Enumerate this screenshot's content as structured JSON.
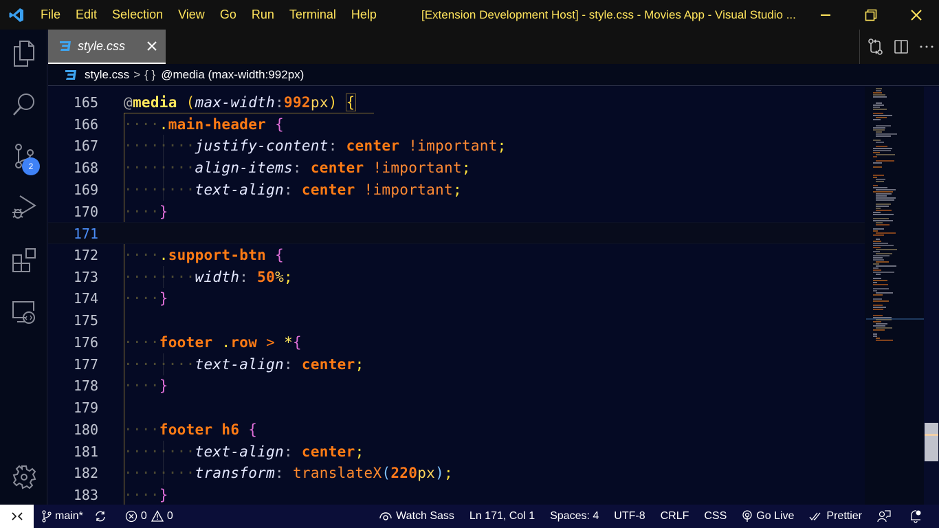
{
  "titlebar": {
    "menu": [
      "File",
      "Edit",
      "Selection",
      "View",
      "Go",
      "Run",
      "Terminal",
      "Help"
    ],
    "window_title": "[Extension Development Host] - style.css - Movies App - Visual Studio ...",
    "icons": [
      "vscode-logo-icon",
      "minimize-icon",
      "restore-icon",
      "close-icon"
    ]
  },
  "activitybar": {
    "items": [
      {
        "name": "explorer",
        "icon": "files-icon"
      },
      {
        "name": "search",
        "icon": "search-icon"
      },
      {
        "name": "source-control",
        "icon": "source-control-icon",
        "badge": "2"
      },
      {
        "name": "run-debug",
        "icon": "run-debug-icon"
      },
      {
        "name": "extensions",
        "icon": "extensions-icon"
      },
      {
        "name": "remote-explorer",
        "icon": "remote-explorer-icon"
      }
    ],
    "manage_icon": "gear-icon"
  },
  "tabs": [
    {
      "label": "style.css",
      "icon": "css-file-icon",
      "active": true
    }
  ],
  "editor_actions": [
    "open-changes-icon",
    "split-editor-icon",
    "more-actions-icon"
  ],
  "breadcrumb": {
    "file": "style.css",
    "separator": ">",
    "symbol_icon": "{ }",
    "symbol": "@media (max-width:992px)"
  },
  "editor": {
    "active_line": 171,
    "lines": [
      {
        "n": "165"
      },
      {
        "n": "166"
      },
      {
        "n": "167"
      },
      {
        "n": "168"
      },
      {
        "n": "169"
      },
      {
        "n": "170"
      },
      {
        "n": "171"
      },
      {
        "n": "172"
      },
      {
        "n": "173"
      },
      {
        "n": "174"
      },
      {
        "n": "175"
      },
      {
        "n": "176"
      },
      {
        "n": "177"
      },
      {
        "n": "178"
      },
      {
        "n": "179"
      },
      {
        "n": "180"
      },
      {
        "n": "181"
      },
      {
        "n": "182"
      },
      {
        "n": "183"
      }
    ],
    "tokens": {
      "l165": {
        "at": "@",
        "kw": "media",
        "open": "(",
        "prop": "max-width",
        "colon": ":",
        "num": "992",
        "unit": "px",
        "close": ")",
        "brace": "{"
      },
      "l166": {
        "dot": ".",
        "sel": "main-header",
        "brace": "{"
      },
      "l167": {
        "prop": "justify-content",
        "colon": ":",
        "val": "center",
        "imp": "!important",
        "semi": ";"
      },
      "l168": {
        "prop": "align-items",
        "colon": ":",
        "val": "center",
        "imp": "!important",
        "semi": ";"
      },
      "l169": {
        "prop": "text-align",
        "colon": ":",
        "val": "center",
        "imp": "!important",
        "semi": ";"
      },
      "l170": {
        "brace": "}"
      },
      "l172": {
        "dot": ".",
        "sel": "support-btn",
        "brace": "{"
      },
      "l173": {
        "prop": "width",
        "colon": ":",
        "num": "50",
        "unit": "%",
        "semi": ";"
      },
      "l174": {
        "brace": "}"
      },
      "l176": {
        "sel1": "footer",
        "dot": ".",
        "sel2": "row",
        "op": ">",
        "star": "*",
        "brace": "{"
      },
      "l177": {
        "prop": "text-align",
        "colon": ":",
        "val": "center",
        "semi": ";"
      },
      "l178": {
        "brace": "}"
      },
      "l180": {
        "sel": "footer h6",
        "brace": "{"
      },
      "l181": {
        "prop": "text-align",
        "colon": ":",
        "val": "center",
        "semi": ";"
      },
      "l182": {
        "prop": "transform",
        "colon": ":",
        "fn": "translateX",
        "open": "(",
        "num": "220",
        "unit": "px",
        "close": ")",
        "semi": ";"
      },
      "l183": {
        "brace": "}"
      }
    },
    "whitespace_4": "····",
    "whitespace_8": "········"
  },
  "statusbar": {
    "remote_icon": "remote-icon",
    "branch": "main*",
    "sync_icon": "sync-icon",
    "errors": "0",
    "warnings": "0",
    "watch_sass": "Watch Sass",
    "cursor_position": "Ln 171, Col 1",
    "indentation": "Spaces: 4",
    "encoding": "UTF-8",
    "eol": "CRLF",
    "language": "CSS",
    "go_live": "Go Live",
    "prettier": "Prettier",
    "icons": [
      "feedback-icon",
      "notifications-icon"
    ]
  },
  "colors": {
    "menu_text": "#ffe45c",
    "editor_bg": "#050a24",
    "statusbar_bg": "#0b0e38",
    "badge": "#3f82f7",
    "active_line_number": "#4a8cf5"
  }
}
